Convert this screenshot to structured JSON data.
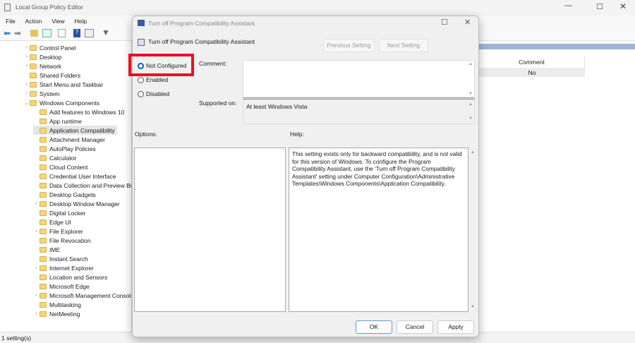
{
  "window": {
    "title": "Local Group Policy Editor",
    "menu": [
      "File",
      "Action",
      "View",
      "Help"
    ],
    "status": "1 setting(s)"
  },
  "tree": [
    {
      "label": "Control Panel",
      "level": 1,
      "arrow": ">"
    },
    {
      "label": "Desktop",
      "level": 1,
      "arrow": ">"
    },
    {
      "label": "Network",
      "level": 1,
      "arrow": ">"
    },
    {
      "label": "Shared Folders",
      "level": 1,
      "arrow": ""
    },
    {
      "label": "Start Menu and Taskbar",
      "level": 1,
      "arrow": ">"
    },
    {
      "label": "System",
      "level": 1,
      "arrow": ">"
    },
    {
      "label": "Windows Components",
      "level": 1,
      "arrow": "v"
    },
    {
      "label": "Add features to Windows 10",
      "level": 2,
      "arrow": ""
    },
    {
      "label": "App runtime",
      "level": 2,
      "arrow": ""
    },
    {
      "label": "Application Compatibility",
      "level": 2,
      "arrow": "",
      "selected": true
    },
    {
      "label": "Attachment Manager",
      "level": 2,
      "arrow": ""
    },
    {
      "label": "AutoPlay Policies",
      "level": 2,
      "arrow": ""
    },
    {
      "label": "Calculator",
      "level": 2,
      "arrow": ""
    },
    {
      "label": "Cloud Content",
      "level": 2,
      "arrow": ""
    },
    {
      "label": "Credential User Interface",
      "level": 2,
      "arrow": ""
    },
    {
      "label": "Data Collection and Preview Builds",
      "level": 2,
      "arrow": ""
    },
    {
      "label": "Desktop Gadgets",
      "level": 2,
      "arrow": ""
    },
    {
      "label": "Desktop Window Manager",
      "level": 2,
      "arrow": ">"
    },
    {
      "label": "Digital Locker",
      "level": 2,
      "arrow": ""
    },
    {
      "label": "Edge UI",
      "level": 2,
      "arrow": ""
    },
    {
      "label": "File Explorer",
      "level": 2,
      "arrow": ">"
    },
    {
      "label": "File Revocation",
      "level": 2,
      "arrow": ""
    },
    {
      "label": "IME",
      "level": 2,
      "arrow": ""
    },
    {
      "label": "Instant Search",
      "level": 2,
      "arrow": ""
    },
    {
      "label": "Internet Explorer",
      "level": 2,
      "arrow": ">"
    },
    {
      "label": "Location and Sensors",
      "level": 2,
      "arrow": ""
    },
    {
      "label": "Microsoft Edge",
      "level": 2,
      "arrow": ""
    },
    {
      "label": "Microsoft Management Console",
      "level": 2,
      "arrow": ">"
    },
    {
      "label": "Multitasking",
      "level": 2,
      "arrow": ""
    },
    {
      "label": "NetMeeting",
      "level": 2,
      "arrow": ">"
    }
  ],
  "list": {
    "column": "Comment",
    "value": "No"
  },
  "dialog": {
    "title": "Turn off Program Compatibility Assistant",
    "setting_name": "Turn off Program Compatibility Assistant",
    "prev": "Previous Setting",
    "next": "Next Setting",
    "radios": [
      {
        "label": "Not Configured",
        "checked": true
      },
      {
        "label": "Enabled",
        "checked": false
      },
      {
        "label": "Disabled",
        "checked": false
      }
    ],
    "comment_label": "Comment:",
    "supported_label": "Supported on:",
    "supported_value": "At least Windows Vista",
    "options_label": "Options:",
    "help_label": "Help:",
    "help_text": "This setting exists only for backward compatibility, and is not valid for this version of Windows. To configure the Program Compatibility Assistant, use the 'Turn off Program Compatibility Assistant' setting under Computer Configuration\\Administrative Templates\\Windows Components\\Application Compatibility.",
    "ok": "OK",
    "cancel": "Cancel",
    "apply": "Apply"
  },
  "colors": {
    "highlight": "#e81123",
    "accent": "#0a5db8"
  }
}
